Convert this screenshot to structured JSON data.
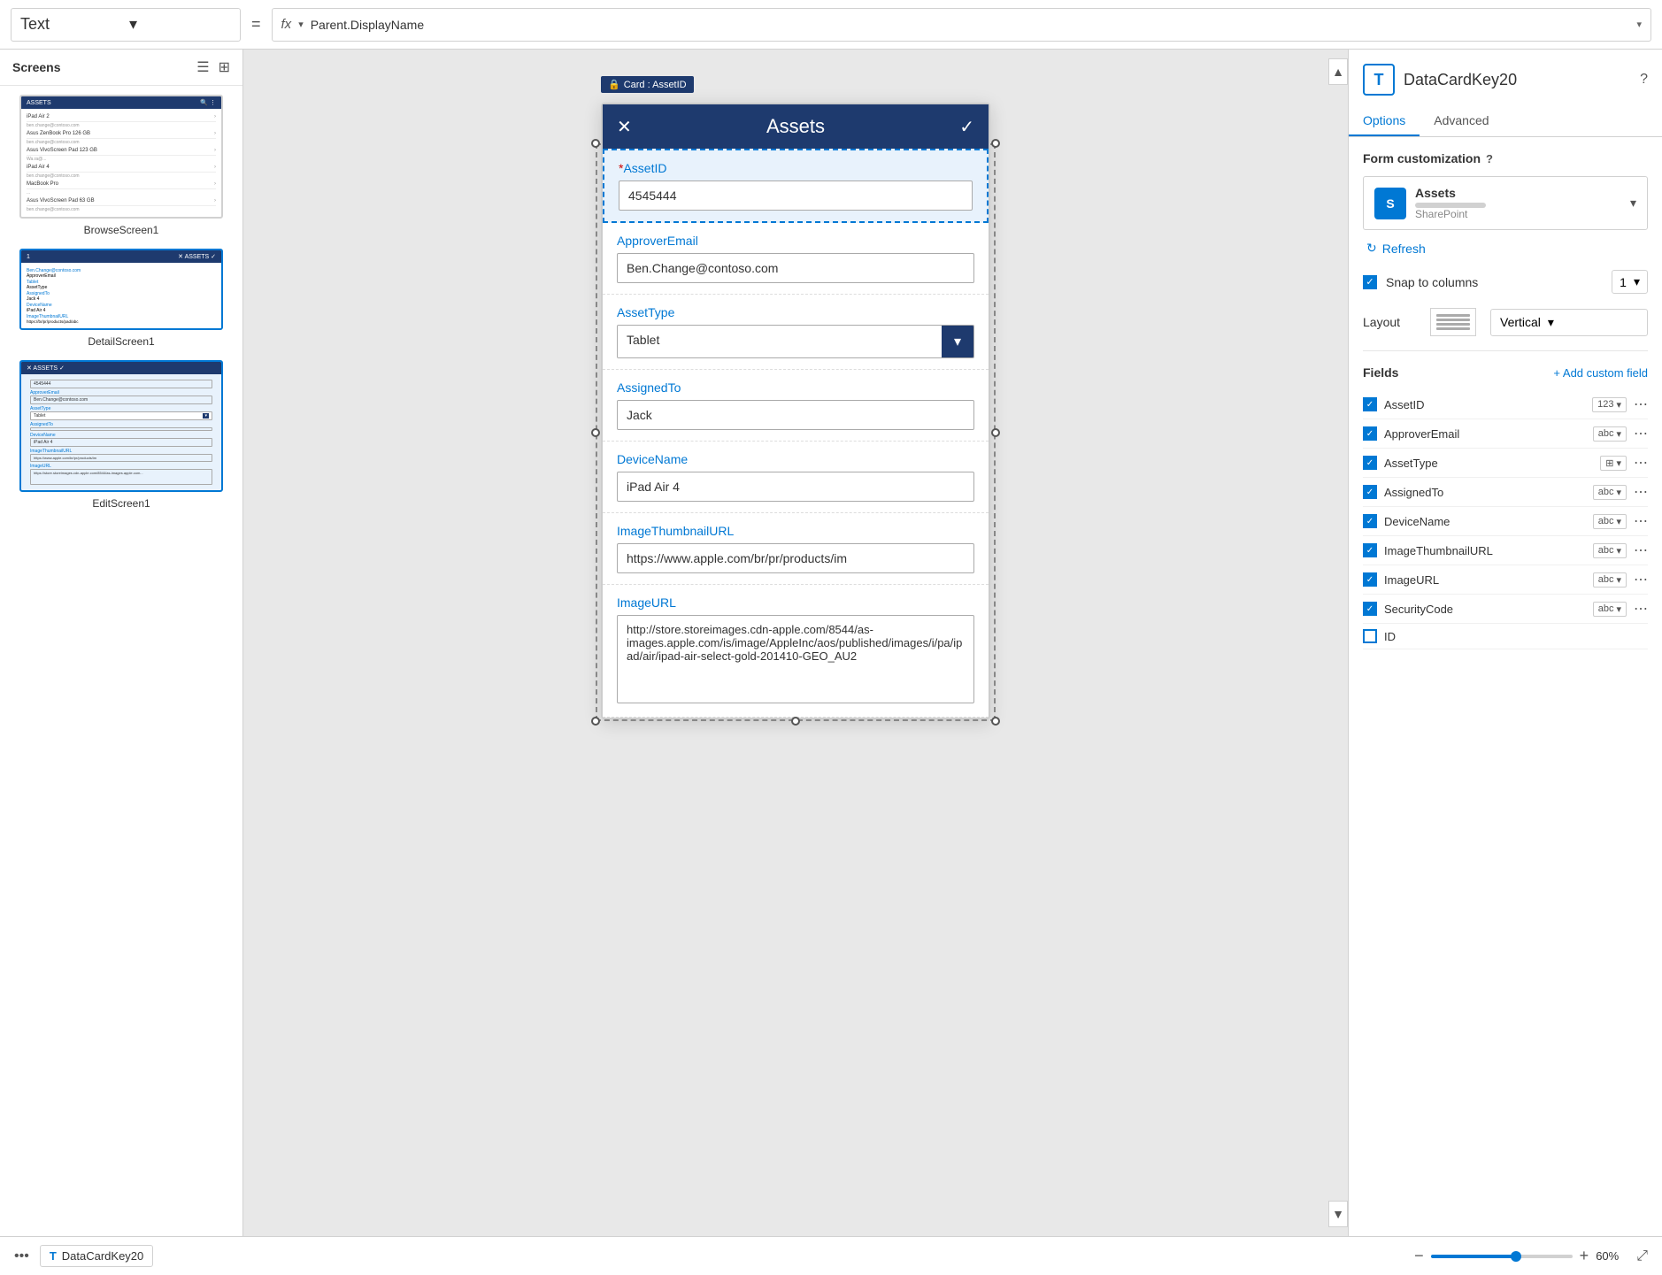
{
  "topbar": {
    "control_type": "Text",
    "equals": "=",
    "fx_label": "fx",
    "formula": "Parent.DisplayName",
    "end_chevron": "▾"
  },
  "sidebar": {
    "title": "Screens",
    "screens": [
      {
        "name": "BrowseScreen1",
        "header": "ASSETS",
        "rows": [
          {
            "label": "iPad Air 2",
            "sub": "ben.change@contoso.com",
            "right": ">"
          },
          {
            "label": "Asus ZenBook Pro 126 GB",
            "sub": "ben.change@contoso.com",
            "right": ">"
          },
          {
            "label": "Asus VivoScreen Pad 123 GB",
            "sub": "Wa.ra@...",
            "right": ">"
          },
          {
            "label": "iPad Air 4",
            "sub": "ben.change@contoso.com",
            "right": ">"
          },
          {
            "label": "MacBook Pro",
            "sub": "...",
            "right": ">"
          },
          {
            "label": "Asus VivoScreen Pad 63 GB",
            "sub": "ben.change@contoso.com",
            "right": ">"
          }
        ]
      },
      {
        "name": "DetailScreen1",
        "header": "< ASSETS",
        "fields": [
          "Ben.Change@contoso.com",
          "ApproverEmail",
          "Tablet",
          "AssetType",
          "AssignedTo",
          "Jack 4",
          "DeviceName",
          "iPad Air 4",
          "ImageThumbnailURL",
          "https://br/pr/products/pad/abc"
        ]
      },
      {
        "name": "EditScreen1",
        "header": "ASSETS",
        "fields": [
          {
            "label": "AssetID",
            "value": "4545444"
          },
          {
            "label": "ApproverEmail",
            "value": "Ben.Change@contoso.com"
          },
          {
            "label": "AssetType",
            "value": "Tablet"
          },
          {
            "label": "AssignedTo",
            "value": ""
          },
          {
            "label": "DeviceName",
            "value": "iPad Air 4"
          },
          {
            "label": "ImageThumbnailURL",
            "value": "https://www.apple.com/br/pr/products/im"
          },
          {
            "label": "ImageURL",
            "value": "https://store.storeimages.cdn-apple.com/8544/as-images.apple.com..."
          }
        ]
      }
    ]
  },
  "canvas": {
    "card_badge": "Card : AssetID",
    "header": {
      "close": "✕",
      "title": "Assets",
      "check": "✓"
    },
    "fields": [
      {
        "name": "AssetID",
        "required": true,
        "value": "4545444",
        "type": "input"
      },
      {
        "name": "ApproverEmail",
        "required": false,
        "value": "Ben.Change@contoso.com",
        "type": "input"
      },
      {
        "name": "AssetType",
        "required": false,
        "value": "Tablet",
        "type": "select"
      },
      {
        "name": "AssignedTo",
        "required": false,
        "value": "Jack",
        "type": "input"
      },
      {
        "name": "DeviceName",
        "required": false,
        "value": "iPad Air 4",
        "type": "input"
      },
      {
        "name": "ImageThumbnailURL",
        "required": false,
        "value": "https://www.apple.com/br/pr/products/im",
        "type": "input"
      },
      {
        "name": "ImageURL",
        "required": false,
        "value": "http://store.storeimages.cdn-apple.com/8544/as-images.apple.com/is/image/AppleInc/aos/published/images/i/pa/ipad/air/ipad-air-select-gold-201410-GEO_AU2",
        "type": "textarea"
      }
    ]
  },
  "right_panel": {
    "title": "DataCardKey20",
    "tabs": [
      "Options",
      "Advanced"
    ],
    "active_tab": "Options",
    "form_customization_label": "Form customization",
    "source": {
      "name": "Assets",
      "type": "SharePoint",
      "icon": "S"
    },
    "refresh_label": "Refresh",
    "snap_to_columns_label": "Snap to columns",
    "columns_value": "1",
    "layout_label": "Layout",
    "layout_value": "Vertical",
    "fields_title": "Fields",
    "add_field_label": "+ Add custom field",
    "fields": [
      {
        "name": "AssetID",
        "checked": true,
        "type": "123",
        "type_icon": "123"
      },
      {
        "name": "ApproverEmail",
        "checked": true,
        "type": "abc"
      },
      {
        "name": "AssetType",
        "checked": true,
        "type": "grid"
      },
      {
        "name": "AssignedTo",
        "checked": true,
        "type": "abc"
      },
      {
        "name": "DeviceName",
        "checked": true,
        "type": "abc"
      },
      {
        "name": "ImageThumbnailURL",
        "checked": true,
        "type": "abc"
      },
      {
        "name": "ImageURL",
        "checked": true,
        "type": "abc"
      },
      {
        "name": "SecurityCode",
        "checked": true,
        "type": "abc"
      },
      {
        "name": "ID",
        "checked": false,
        "type": ""
      }
    ]
  },
  "bottom_bar": {
    "dots": "•••",
    "card_label": "DataCardKey20",
    "card_icon": "T",
    "zoom_minus": "−",
    "zoom_pct": "60%",
    "zoom_plus": "+"
  }
}
